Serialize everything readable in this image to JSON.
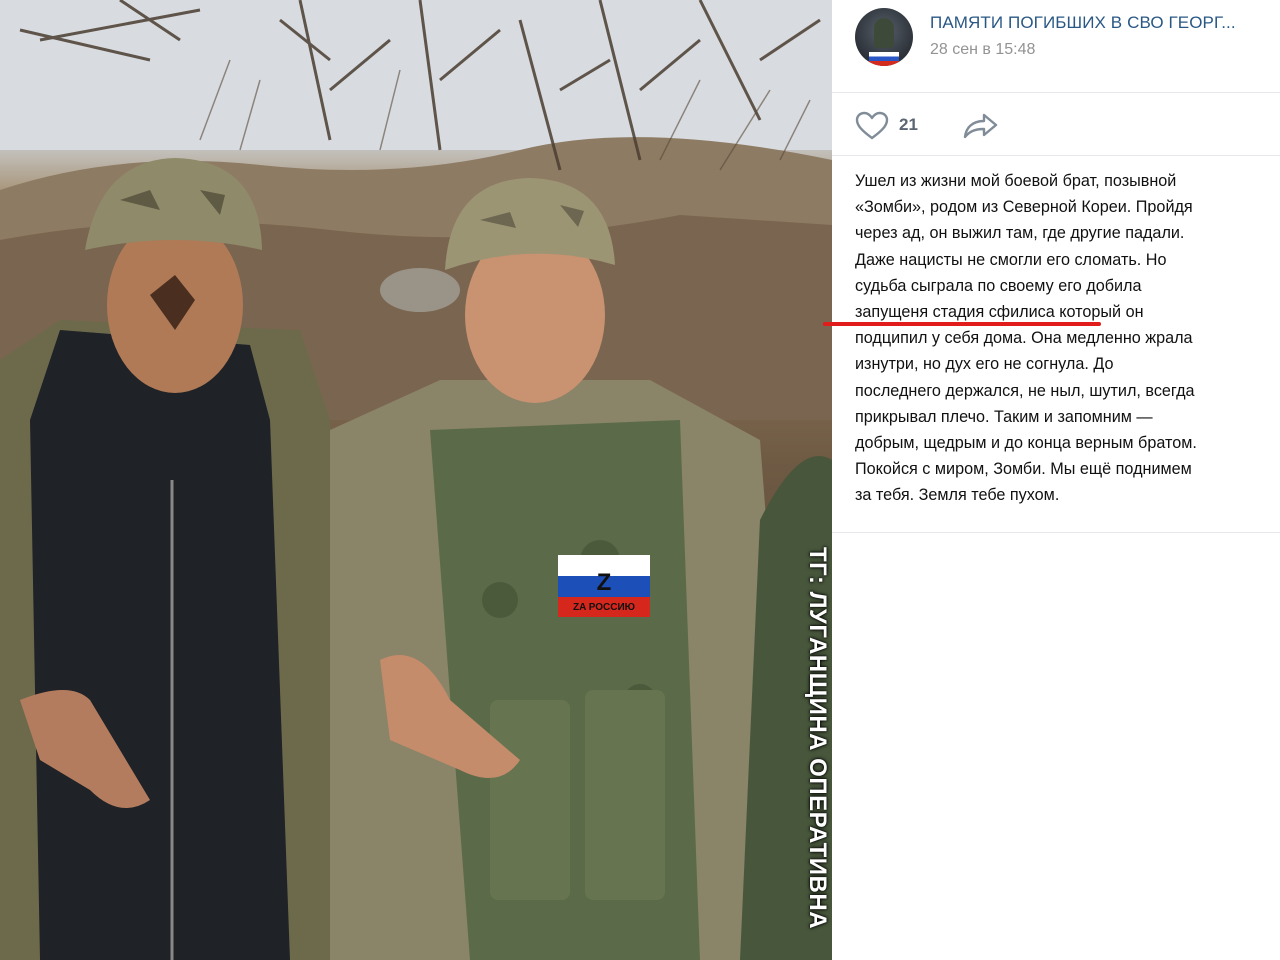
{
  "post": {
    "group_name": "ПАМЯТИ ПОГИБШИХ В СВО ГЕОРГ...",
    "time": "28 сен в 15:48",
    "likes": "21",
    "text_lines": [
      "Ушел из жизни мой боевой брат, позывной",
      "«Зомби», родом из Северной Кореи. Пройдя",
      "через ад, он выжил там, где другие падали.",
      "Даже нацисты не смогли его сломать. Но",
      "судьба сыграла по своему его добила",
      "запущеня стадия сфилиса который он",
      "подципил у себя дома. Она медленно жрала",
      "изнутри, но дух его не согнула. До",
      "последнего держался, не ныл, шутил, всегда",
      "прикрывал плечо. Таким и запомним —",
      "добрым, щедрым и до конца верным братом.",
      "Покойся с миром, Зомби. Мы ещё поднимем",
      "за тебя. Земля тебе пухом."
    ]
  },
  "photo": {
    "patch_letter": "Z",
    "patch_text": "ZA РОССИЮ",
    "watermark": "ТГ: ЛУГАНЩИНА ОПЕРАТИВНА"
  },
  "colors": {
    "group_link": "#2a5885",
    "meta_gray": "#939393",
    "action_gray": "#5c6573",
    "highlight_red": "#e21b1b"
  },
  "icons": [
    "heart-icon",
    "share-arrow-icon"
  ]
}
